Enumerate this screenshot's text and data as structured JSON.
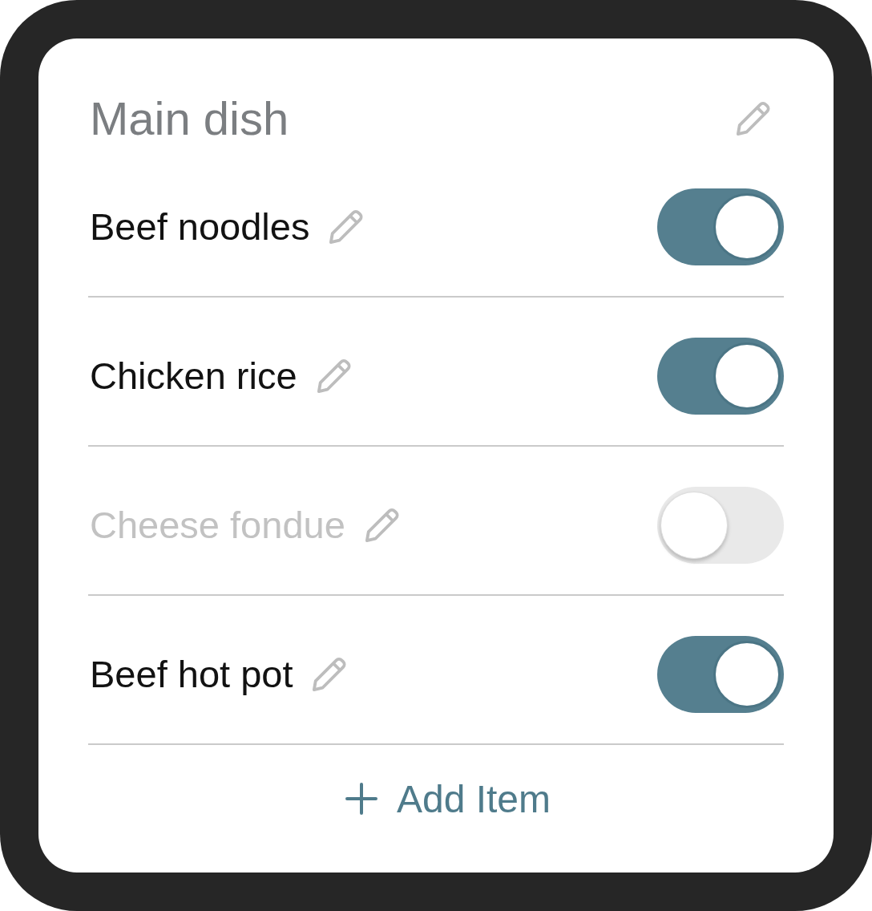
{
  "card": {
    "title": "Main dish"
  },
  "items": [
    {
      "name": "Beef noodles",
      "on": true
    },
    {
      "name": "Chicken rice",
      "on": true
    },
    {
      "name": "Cheese fondue",
      "on": false
    },
    {
      "name": "Beef hot pot",
      "on": true
    }
  ],
  "add_button": {
    "label": "Add Item"
  }
}
